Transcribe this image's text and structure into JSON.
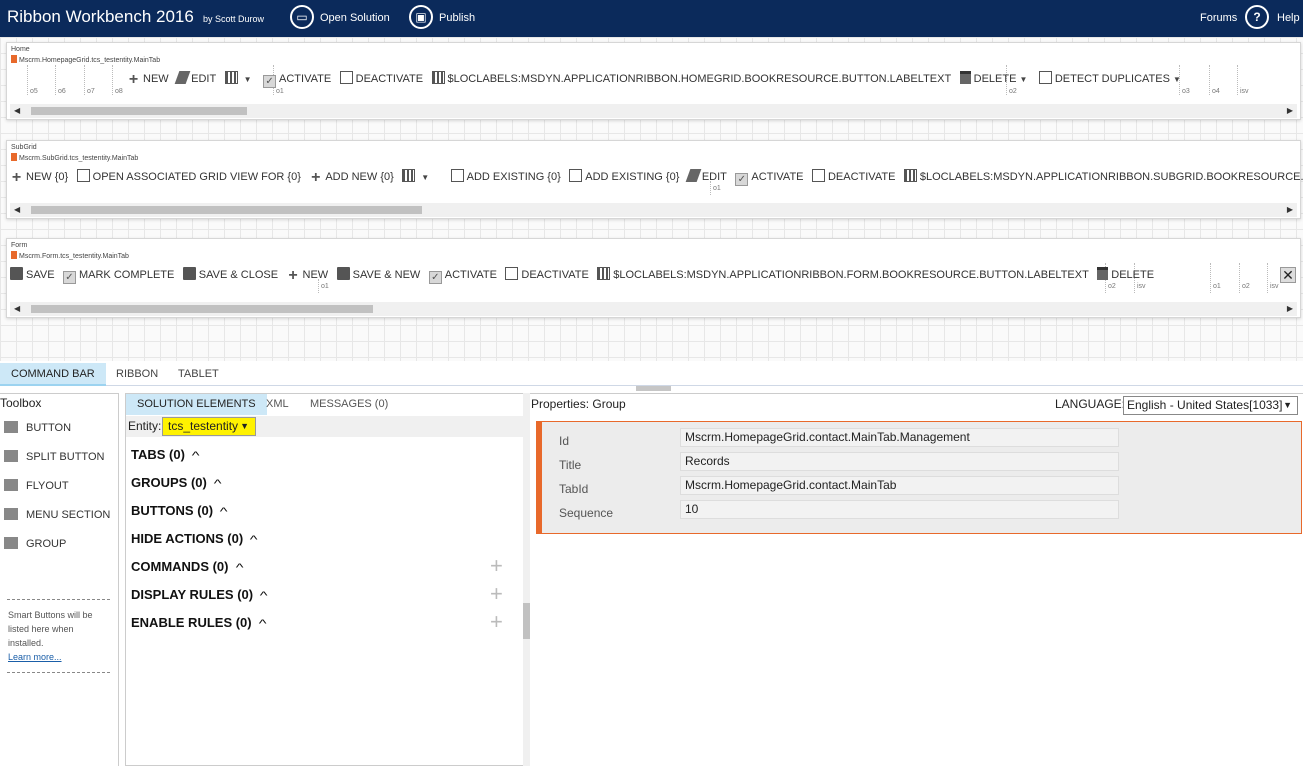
{
  "app": {
    "title": "Ribbon Workbench 2016",
    "byline": "by Scott Durow",
    "open_solution": "Open Solution",
    "publish": "Publish",
    "forums": "Forums",
    "help": "Help",
    "help_glyph": "?"
  },
  "ribbons": {
    "home": {
      "label": "Home",
      "tab_id": "Mscrm.HomepageGrid.tcs_testentity.MainTab",
      "buttons": [
        "NEW",
        "EDIT",
        "ACTIVATE",
        "DEACTIVATE",
        "$LOCLABELS:MSDYN.APPLICATIONRIBBON.HOMEGRID.BOOKRESOURCE.BUTTON.LABELTEXT",
        "DELETE",
        "DETECT DUPLICATES"
      ],
      "ticks": [
        "o5",
        "o6",
        "o7",
        "o8",
        "o1",
        "o2",
        "o3",
        "o4",
        "isv"
      ]
    },
    "subgrid": {
      "label": "SubGrid",
      "tab_id": "Mscrm.SubGrid.tcs_testentity.MainTab",
      "buttons": [
        "NEW {0}",
        "OPEN ASSOCIATED GRID VIEW FOR {0}",
        "ADD NEW {0}",
        "ADD EXISTING {0}",
        "ADD EXISTING {0}",
        "EDIT",
        "ACTIVATE",
        "DEACTIVATE",
        "$LOCLABELS:MSDYN.APPLICATIONRIBBON.SUBGRID.BOOKRESOURCE.BUTTON.L"
      ],
      "ticks": [
        "o1"
      ]
    },
    "form": {
      "label": "Form",
      "tab_id": "Mscrm.Form.tcs_testentity.MainTab",
      "buttons": [
        "SAVE",
        "MARK COMPLETE",
        "SAVE & CLOSE",
        "NEW",
        "SAVE & NEW",
        "ACTIVATE",
        "DEACTIVATE",
        "$LOCLABELS:MSDYN.APPLICATIONRIBBON.FORM.BOOKRESOURCE.BUTTON.LABELTEXT",
        "DELETE"
      ],
      "ticks": [
        "o1",
        "o2",
        "isv",
        "o1",
        "o2",
        "isv"
      ]
    }
  },
  "main_tabs": [
    "COMMAND BAR",
    "RIBBON",
    "TABLET"
  ],
  "toolbox": {
    "title": "Toolbox",
    "items": [
      "BUTTON",
      "SPLIT BUTTON",
      "FLYOUT",
      "MENU SECTION",
      "GROUP"
    ],
    "smart_text": "Smart Buttons will be listed here when installed.",
    "learn_more": "Learn more..."
  },
  "solution": {
    "tabs": [
      "SOLUTION ELEMENTS",
      "XML",
      "MESSAGES (0)"
    ],
    "entity_label": "Entity:",
    "entity_value": "tcs_testentity",
    "sections": [
      "TABS (0)",
      "GROUPS (0)",
      "BUTTONS (0)",
      "HIDE ACTIONS (0)",
      "COMMANDS (0)",
      "DISPLAY RULES (0)",
      "ENABLE RULES (0)"
    ]
  },
  "properties": {
    "title": "Properties: Group",
    "language_label": "LANGUAGE:",
    "language_value": "English - United States[1033]",
    "fields": [
      {
        "label": "Id",
        "value": "Mscrm.HomepageGrid.contact.MainTab.Management"
      },
      {
        "label": "Title",
        "value": "Records"
      },
      {
        "label": "TabId",
        "value": "Mscrm.HomepageGrid.contact.MainTab"
      },
      {
        "label": "Sequence",
        "value": "10"
      }
    ]
  },
  "colors": {
    "topbar": "#0b2a5b",
    "accent": "#e8692b",
    "highlight": "#fff200",
    "tab_active": "#cde8f7"
  }
}
